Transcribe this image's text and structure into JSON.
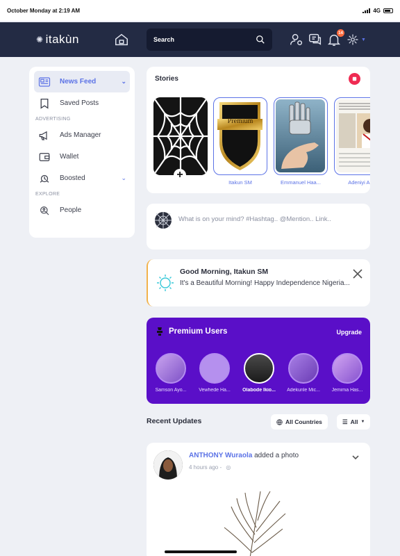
{
  "status": {
    "time": "October Monday at 2:19 AM",
    "network": "4G"
  },
  "nav": {
    "logo_text": "itakùn",
    "search_placeholder": "Search",
    "notifications_count": "14"
  },
  "sidebar": {
    "items": [
      {
        "label": "News Feed",
        "icon": "newspaper-icon",
        "active": true
      },
      {
        "label": "Saved Posts",
        "icon": "bookmark-icon"
      }
    ],
    "advertising_header": "ADVERTISING",
    "advertising": [
      {
        "label": "Ads Manager",
        "icon": "megaphone-icon"
      },
      {
        "label": "Wallet",
        "icon": "wallet-icon"
      },
      {
        "label": "Boosted",
        "icon": "rocket-icon"
      }
    ],
    "explore_header": "EXPLORE",
    "explore": [
      {
        "label": "People",
        "icon": "people-search-icon"
      }
    ]
  },
  "stories": {
    "title": "Stories",
    "items": [
      {
        "name": "",
        "kind": "create-story"
      },
      {
        "name": "Itakun SM",
        "kind": "premium-banner",
        "banner_text": "Premium"
      },
      {
        "name": "Emmanuel Haa...",
        "kind": "robot-hand"
      },
      {
        "name": "Adeniyi A...",
        "kind": "newspaper"
      }
    ]
  },
  "composer": {
    "placeholder": "What is on your mind? #Hashtag.. @Mention.. Link.."
  },
  "greeting": {
    "title": "Good Morning, Itakun SM",
    "body": "It's a Beautiful Morning! Happy Independence Nigeria..."
  },
  "premium": {
    "title": "Premium Users",
    "upgrade_label": "Upgrade",
    "users": [
      {
        "name": "Samson Ayo...",
        "bold": false
      },
      {
        "name": "Vewhede Ha...",
        "bold": false
      },
      {
        "name": "Olabode Ikio...",
        "bold": true
      },
      {
        "name": "Adekunle Mic...",
        "bold": false
      },
      {
        "name": "Jemima Has...",
        "bold": false
      }
    ]
  },
  "recent": {
    "title": "Recent Updates",
    "countries_label": "All Countries",
    "filter_label": "All"
  },
  "post": {
    "username": "ANTHONY Wuraola",
    "action": " added a photo",
    "time": "4 hours ago -"
  },
  "colors": {
    "nav_bg": "#232b44",
    "accent": "#5b72e6",
    "premium_bg": "#5a0fc8",
    "record": "#ef2b52"
  }
}
